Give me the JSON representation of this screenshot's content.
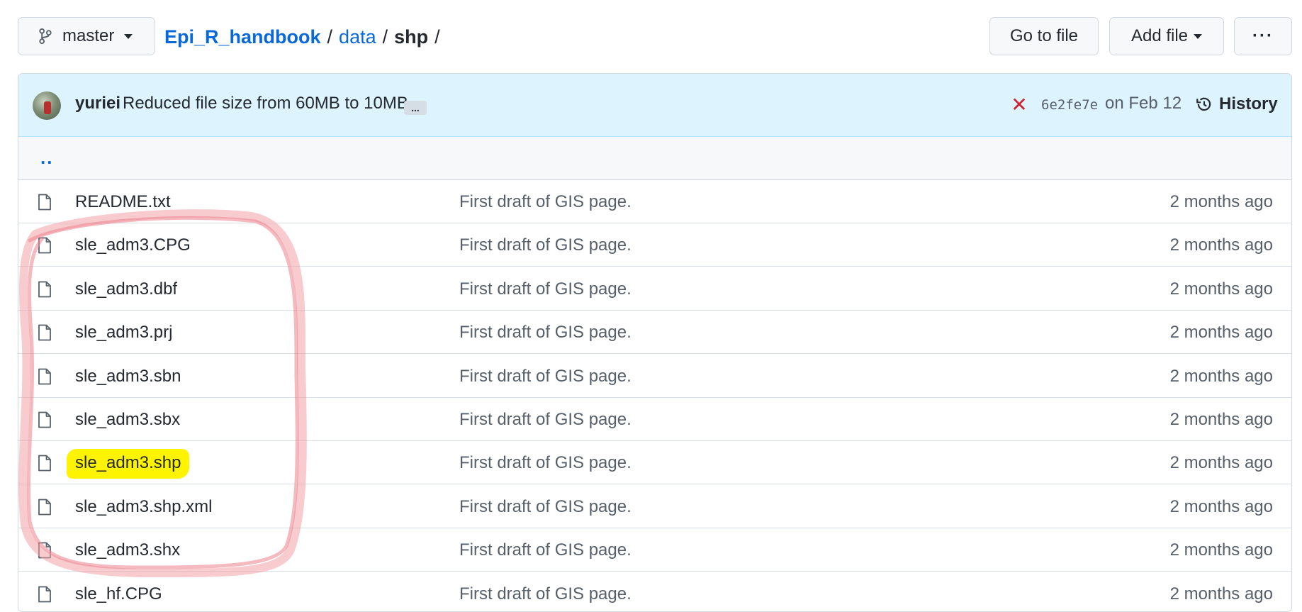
{
  "branch": {
    "label": "master"
  },
  "breadcrumb": {
    "repo": "Epi_R_handbook",
    "folder": "data",
    "current": "shp",
    "separator": "/"
  },
  "actions": {
    "goto_label": "Go to file",
    "add_label": "Add file",
    "more_label": "···"
  },
  "commit": {
    "author": "yuriei",
    "message": "Reduced file size from 60MB to 10MB",
    "ellipsis": "...",
    "status": "✕",
    "sha": "6e2fe7e",
    "date": "on Feb 12",
    "history_label": "History"
  },
  "parent_link": "..",
  "files": [
    {
      "name": "README.txt",
      "message": "First draft of GIS page.",
      "age": "2 months ago"
    },
    {
      "name": "sle_adm3.CPG",
      "message": "First draft of GIS page.",
      "age": "2 months ago"
    },
    {
      "name": "sle_adm3.dbf",
      "message": "First draft of GIS page.",
      "age": "2 months ago"
    },
    {
      "name": "sle_adm3.prj",
      "message": "First draft of GIS page.",
      "age": "2 months ago"
    },
    {
      "name": "sle_adm3.sbn",
      "message": "First draft of GIS page.",
      "age": "2 months ago"
    },
    {
      "name": "sle_adm3.sbx",
      "message": "First draft of GIS page.",
      "age": "2 months ago"
    },
    {
      "name": "sle_adm3.shp",
      "message": "First draft of GIS page.",
      "age": "2 months ago"
    },
    {
      "name": "sle_adm3.shp.xml",
      "message": "First draft of GIS page.",
      "age": "2 months ago"
    },
    {
      "name": "sle_adm3.shx",
      "message": "First draft of GIS page.",
      "age": "2 months ago"
    },
    {
      "name": "sle_hf.CPG",
      "message": "First draft of GIS page.",
      "age": "2 months ago"
    }
  ],
  "colors": {
    "link": "#0969da",
    "highlight": "#fff400",
    "annotation": "#f2a0a8",
    "error": "#cf222e"
  }
}
